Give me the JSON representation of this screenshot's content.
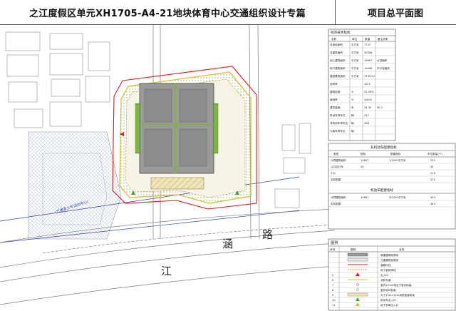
{
  "header": {
    "title": "之江度假区单元XH1705-A4-21地块体育中心交通组织设计专篇",
    "drawing_name": "项目总平面图"
  },
  "map": {
    "road_label_chars": [
      "江",
      "涵",
      "路"
    ],
    "park_label": "(已建青少年活动中心)"
  },
  "tech_table": {
    "title": "经济技术指标",
    "columns": [
      "名称",
      "单位",
      "数值",
      "备注说明"
    ],
    "rows": [
      [
        "总用地面积",
        "平方米",
        "7737",
        ""
      ],
      [
        "总建筑面积",
        "平方米",
        "30356",
        ""
      ],
      [
        "地上建筑面积",
        "平方米",
        "19697",
        "计容面积"
      ],
      [
        "地下建筑面积",
        "平方米",
        "10446",
        "不计容面积"
      ],
      [
        "建筑基底面积",
        "平方米",
        "3759.54",
        ""
      ],
      [
        "容积率",
        "",
        "≤2.5",
        ""
      ],
      [
        "建筑密度",
        "%",
        "52.59%",
        ""
      ],
      [
        "绿地率",
        "%",
        "≥20%",
        ""
      ],
      [
        "建筑高度",
        "米",
        "34.30",
        "30.2"
      ],
      [
        "机动车停车位",
        "辆",
        "227",
        ""
      ],
      [
        "非机动车停车位",
        "辆",
        "268",
        ""
      ],
      [
        "大客车停车位",
        "辆",
        "",
        ""
      ]
    ]
  },
  "parking_table": {
    "title": "非机动车配建指标",
    "columns": [
      "类型",
      "指标",
      "配建指标",
      "车位数量(个)"
    ],
    "rows": [
      [
        "计算建筑面积",
        "19697",
        "1/1000平方米",
        "225"
      ],
      [
        "公共自行车",
        "20",
        "",
        "45"
      ],
      [
        "小计",
        "",
        "",
        "270"
      ],
      [
        "实际配建",
        "",
        "",
        "272"
      ]
    ],
    "second_title": "机动车配建指标",
    "second_rows": [
      [
        "计算建筑面积",
        "19697",
        "3/1000平方米",
        "493"
      ],
      [
        "实际配建",
        "",
        "",
        "343"
      ]
    ]
  },
  "legend": {
    "title": "图例",
    "columns": [
      "序号",
      "图例",
      "名称"
    ],
    "items": [
      {
        "no": "",
        "name": "新建建筑轮廓线"
      },
      {
        "no": "",
        "name": "已建建筑轮廓线"
      },
      {
        "no": "",
        "name": "道路红线"
      },
      {
        "no": "",
        "name": "地下室轮廓线"
      },
      {
        "no": "5",
        "name": "出入口"
      },
      {
        "no": "6",
        "name": "消防车道"
      },
      {
        "no": "7",
        "name": "室内±0.00相当于绝对标高"
      },
      {
        "no": "8",
        "name": "室外地坪标高"
      },
      {
        "no": "9",
        "name": "大于15m×15m消防登高场地"
      },
      {
        "no": "10",
        "name": "机动车出入口"
      },
      {
        "no": "11",
        "name": "地下车库出入口"
      }
    ]
  },
  "colors": {
    "site_boundary": "#e01818",
    "building": "#9a9a9a",
    "green_band": "#9ed14a",
    "road_line": "#7a7a7a",
    "water_line": "#2b3fb0",
    "hatch": "#c9a66b"
  }
}
